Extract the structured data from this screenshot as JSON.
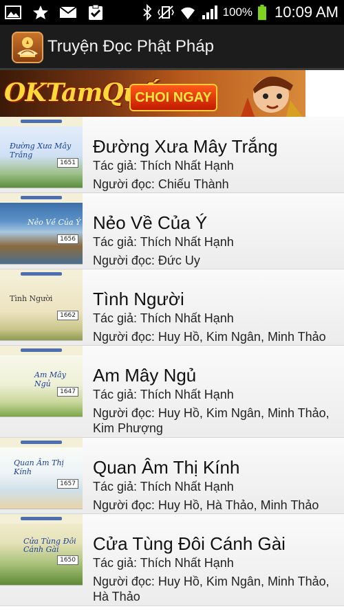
{
  "status_bar": {
    "battery_text": "100%",
    "time": "10:09 AM",
    "icons": [
      "image-icon",
      "star-icon",
      "mail-icon",
      "clipboard-check-icon",
      "bluetooth-icon",
      "vibrate-mute-icon",
      "wifi-icon",
      "signal-icon",
      "battery-icon"
    ]
  },
  "action_bar": {
    "title": "Truyện Đọc Phật Pháp",
    "icon": "lotus-app-icon"
  },
  "banner": {
    "logo_text": "OKTamQuốc",
    "button_label": "CHOI NGAY"
  },
  "stories": [
    {
      "title": "Đường Xưa Mây Trắng",
      "author": "Tác giả: Thích Nhất Hạnh",
      "reader": "Người đọc: Chiếu Thành",
      "thumb_caption": "Đường Xưa Mây Trắng",
      "thumb_number": "1651"
    },
    {
      "title": "Nẻo Về Của Ý",
      "author": "Tác giả: Thích Nhất Hạnh",
      "reader": "Người đọc: Đức Uy",
      "thumb_caption": "Nẻo Về Của Ý",
      "thumb_number": "1656"
    },
    {
      "title": "Tình Người",
      "author": "Tác giả: Thích Nhất Hạnh",
      "reader": "Người đọc: Huy Hồ, Kim Ngân, Minh Thảo",
      "thumb_caption": "Tình Người",
      "thumb_number": "1662"
    },
    {
      "title": "Am Mây Ngủ",
      "author": "Tác giả: Thích Nhất Hạnh",
      "reader": "Người đọc: Huy Hồ, Kim Ngân, Minh Thảo, Kim Phượng",
      "thumb_caption": "Am Mây Ngủ",
      "thumb_number": "1647"
    },
    {
      "title": "Quan Âm Thị Kính",
      "author": "Tác giả: Thích Nhất Hạnh",
      "reader": "Người đọc: Huy Hồ, Hà Thảo, Minh Thảo",
      "thumb_caption": "Quan Âm Thị Kính",
      "thumb_number": "1657"
    },
    {
      "title": "Cửa Tùng Đôi Cánh Gài",
      "author": "Tác giả: Thích Nhất Hạnh",
      "reader": "Người đọc: Huy Hồ, Kim Ngân, Minh Thảo, Hà Thảo",
      "thumb_caption": "Cửa Tùng Đôi Cánh Gài",
      "thumb_number": "1650"
    }
  ]
}
